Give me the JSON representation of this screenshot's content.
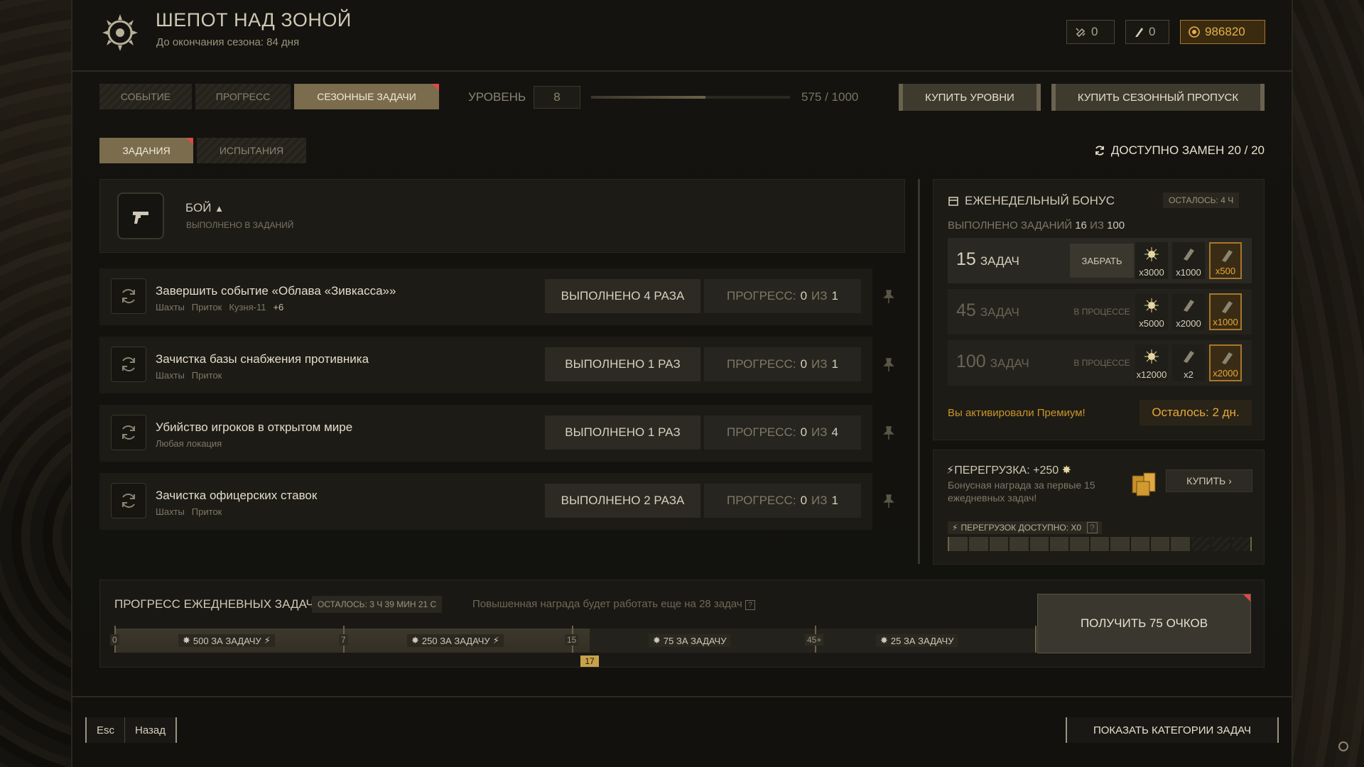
{
  "header": {
    "title": "ШЕПОТ НАД ЗОНОЙ",
    "subtitle": "До окончания сезона: 84 дня",
    "currencies": [
      {
        "icon": "link-token-icon",
        "value": "0"
      },
      {
        "icon": "feather-token-icon",
        "value": "0"
      },
      {
        "icon": "coin-icon",
        "value": "986820"
      }
    ]
  },
  "nav": {
    "tabs": [
      "СОБЫТИЕ",
      "ПРОГРЕСС",
      "СЕЗОННЫЕ ЗАДАЧИ"
    ],
    "active_tab": "СЕЗОННЫЕ ЗАДАЧИ",
    "level_label": "УРОВЕНЬ",
    "level": "8",
    "level_progress": 0.575,
    "level_count": "575 / 1000",
    "buy_levels": "КУПИТЬ УРОВНИ",
    "buy_pass": "КУПИТЬ СЕЗОННЫЙ ПРОПУСК"
  },
  "subtabs": {
    "tabs": [
      "ЗАДАНИЯ",
      "ИСПЫТАНИЯ"
    ],
    "active": "ЗАДАНИЯ",
    "replacements": "ДОСТУПНО ЗАМЕН 20 / 20"
  },
  "category": {
    "title": "БОЙ",
    "subtitle": "ВЫПОЛНЕНО В ЗАДАНИЙ"
  },
  "tasks": [
    {
      "title": "Завершить событие «Облава «Зивкасса»»",
      "tags": [
        "Шахты",
        "Приток",
        "Кузня-11"
      ],
      "more": "+6",
      "done": "ВЫПОЛНЕНО 4 РАЗА",
      "progress_label": "ПРОГРЕСС:",
      "progress_cur": "0",
      "progress_of": "ИЗ",
      "progress_total": "1"
    },
    {
      "title": "Зачистка базы снабжения противника",
      "tags": [
        "Шахты",
        "Приток"
      ],
      "more": "",
      "done": "ВЫПОЛНЕНО 1 РАЗ",
      "progress_label": "ПРОГРЕСС:",
      "progress_cur": "0",
      "progress_of": "ИЗ",
      "progress_total": "1"
    },
    {
      "title": "Убийство игроков в открытом мире",
      "tags": [
        "Любая локация"
      ],
      "more": "",
      "done": "ВЫПОЛНЕНО 1 РАЗ",
      "progress_label": "ПРОГРЕСС:",
      "progress_cur": "0",
      "progress_of": "ИЗ",
      "progress_total": "4"
    },
    {
      "title": "Зачистка офицерских ставок",
      "tags": [
        "Шахты",
        "Приток"
      ],
      "more": "",
      "done": "ВЫПОЛНЕНО 2 РАЗА",
      "progress_label": "ПРОГРЕСС:",
      "progress_cur": "0",
      "progress_of": "ИЗ",
      "progress_total": "1"
    }
  ],
  "weekly": {
    "title": "ЕЖЕНЕДЕЛЬНЫЙ БОНУС",
    "time_left": "ОСТАЛОСЬ: 4 ч",
    "done_label": "ВЫПОЛНЕНО ЗАДАНИЙ",
    "done_cur": "16",
    "done_of": "ИЗ",
    "done_total": "100",
    "tiers": [
      {
        "count": "15",
        "unit": "ЗАДАЧ",
        "action": "ЗАБРАТЬ",
        "rewards": [
          "x3000",
          "x1000",
          "x500"
        ]
      },
      {
        "count": "45",
        "unit": "ЗАДАЧ",
        "status": "В ПРОЦЕССЕ",
        "rewards": [
          "x5000",
          "x2000",
          "x1000"
        ]
      },
      {
        "count": "100",
        "unit": "ЗАДАЧ",
        "status": "В ПРОЦЕССЕ",
        "rewards": [
          "x12000",
          "x2",
          "x2000"
        ]
      }
    ],
    "premium_msg": "Вы активировали Премиум!",
    "premium_left": "Осталось: 2 дн."
  },
  "overload": {
    "title": "ПЕРЕГРУЗКА: +250",
    "desc": "Бонусная награда за первые 15 ежедневных задач!",
    "buy": "КУПИТЬ",
    "available": "ПЕРЕГРУЗОК ДОСТУПНО: x0",
    "segments_filled": 12,
    "segments_total": 15
  },
  "daily": {
    "title": "ПРОГРЕСС ЕЖЕДНЕВНЫХ ЗАДАЧ",
    "time_left": "ОСТАЛОСЬ: 3 ч 39 мин 21 с",
    "note": "Повышенная награда будет работать еще на 28 задач",
    "marks": [
      "0",
      "7",
      "15",
      "45+"
    ],
    "segments": [
      "500 ЗА ЗАДАЧУ",
      "250 ЗА ЗАДАЧУ",
      "75 ЗА ЗАДАЧУ",
      "25 ЗА ЗАДАЧУ"
    ],
    "current": "17",
    "claim": "ПОЛУЧИТЬ 75 ОЧКОВ"
  },
  "footer": {
    "esc": "Esc",
    "back": "Назад",
    "show_categories": "ПОКАЗАТЬ КАТЕГОРИИ ЗАДАЧ"
  },
  "colors": {
    "accent_gold": "#e6a83a",
    "alert_red": "#e04848"
  }
}
